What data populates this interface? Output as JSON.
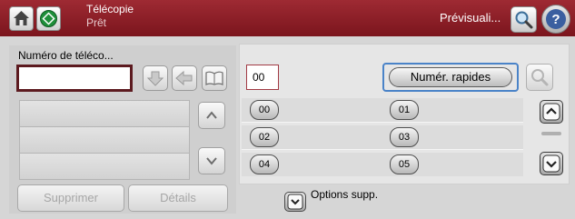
{
  "header": {
    "app_title": "Télécopie",
    "app_status": "Prêt",
    "preview_label": "Prévisuali..."
  },
  "left": {
    "number_label": "Numéro de téléco...",
    "number_value": "",
    "list_rows": [
      "",
      "",
      ""
    ],
    "delete_label": "Supprimer",
    "details_label": "Détails"
  },
  "right": {
    "code_value": "00",
    "speed_dials_label": "Numér. rapides",
    "entries": [
      "00",
      "01",
      "02",
      "03",
      "04",
      "05"
    ],
    "options_label": "Options supp."
  },
  "colors": {
    "topbar": "#8b1e27",
    "selection_outline": "#4a83c8",
    "input_border": "#5c1a1f"
  }
}
